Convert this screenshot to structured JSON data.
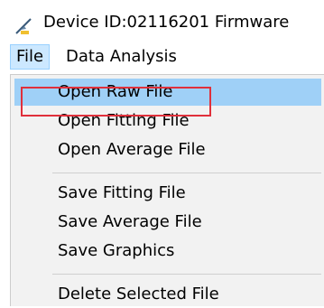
{
  "window": {
    "title": "Device ID:02116201  Firmware",
    "icon": "feather-pen-icon"
  },
  "menubar": {
    "items": [
      {
        "label": "File",
        "active": true
      },
      {
        "label": "Data Analysis",
        "active": false
      }
    ]
  },
  "file_menu": {
    "groups": [
      [
        "Open Raw File",
        "Open Fitting File",
        "Open Average File"
      ],
      [
        "Save Fitting File",
        "Save Average File",
        "Save Graphics"
      ],
      [
        "Delete Selected File"
      ]
    ],
    "highlighted": "Open Raw File"
  },
  "colors": {
    "menu_background": "#f2f2f2",
    "highlight": "#9fd0f7",
    "active_menubar_item": "#cce8ff",
    "annotation": "#e0303b"
  }
}
